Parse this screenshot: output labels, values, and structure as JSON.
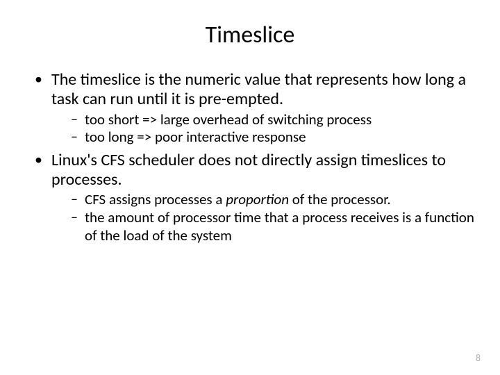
{
  "title": "Timeslice",
  "bullets": [
    {
      "text": "The timeslice is the numeric value that represents how long a task can run until it is pre-empted.",
      "sub": [
        "too short => large overhead of switching process",
        "too long => poor interactive response"
      ]
    },
    {
      "text": "Linux's CFS scheduler does not directly assign timeslices to processes.",
      "sub": [
        "CFS assigns processes a <i>proportion</i> of the processor.",
        "the amount of processor time that a process receives is a function of the load of the system"
      ]
    }
  ],
  "page_number": "8"
}
